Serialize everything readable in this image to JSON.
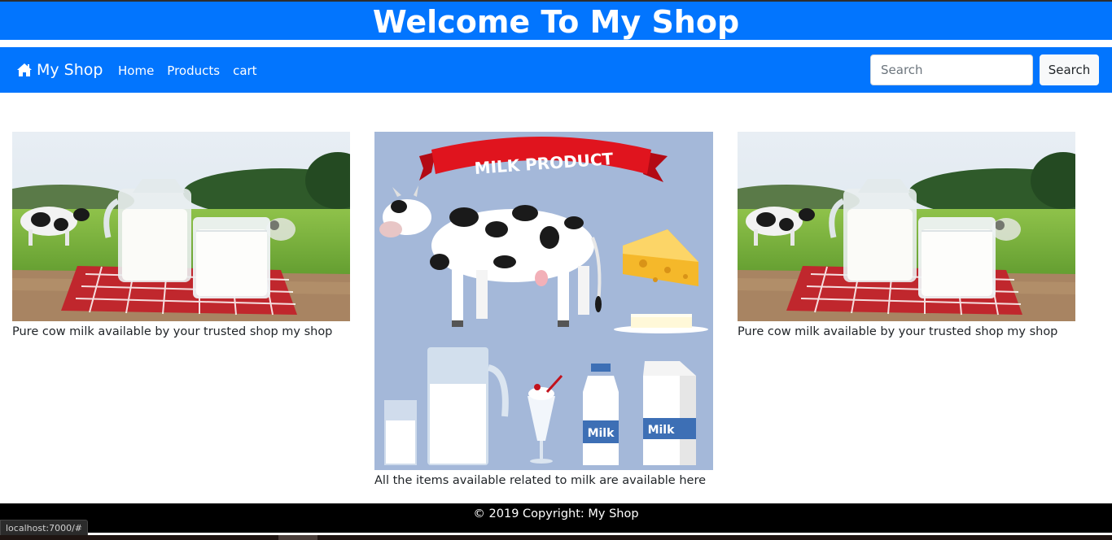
{
  "header": {
    "title": "Welcome To My Shop"
  },
  "navbar": {
    "brand": "My Shop",
    "brand_icon": "home-icon",
    "links": [
      "Home",
      "Products",
      "cart"
    ],
    "search": {
      "placeholder": "Search",
      "value": "",
      "button_label": "Search"
    }
  },
  "products": [
    {
      "caption": "Pure cow milk available by your trusted shop my shop"
    },
    {
      "caption": "All the items available related to milk are available here",
      "banner_text": "MILK PRODUCT",
      "bottle_label": "Milk",
      "carton_label": "Milk"
    },
    {
      "caption": "Pure cow milk available by your trusted shop my shop"
    }
  ],
  "footer": {
    "text": "© 2019 Copyright: My Shop"
  },
  "status_bar": {
    "url": "localhost:7000/#"
  },
  "colors": {
    "primary": "#0275fe",
    "footer_bg": "#000000",
    "illustration_bg": "#a4b8d9"
  }
}
